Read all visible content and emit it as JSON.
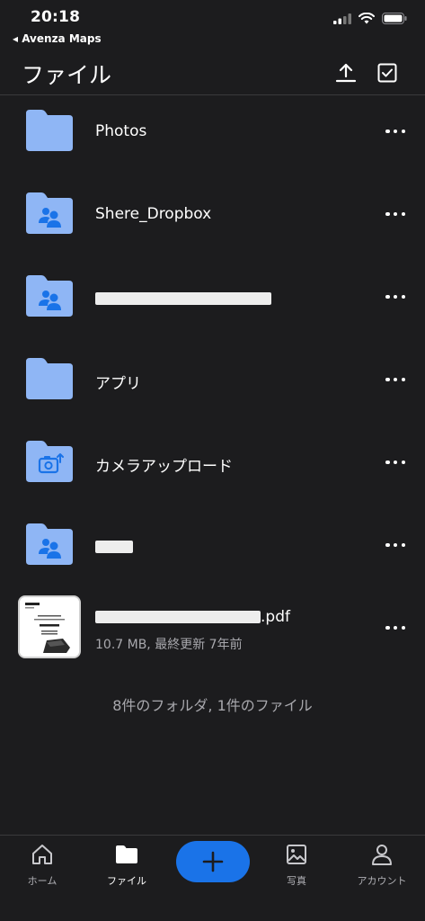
{
  "status": {
    "time": "20:18",
    "back_app": "◂ Avenza Maps"
  },
  "nav": {
    "title": "ファイル",
    "upload_icon": "upload-icon",
    "select_icon": "checkbox-icon"
  },
  "items": [
    {
      "name": "Photos",
      "icon": "folder-icon"
    },
    {
      "name": "Shere_Dropbox",
      "icon": "shared-folder-icon"
    },
    {
      "name": "",
      "icon": "shared-folder-icon"
    },
    {
      "name": "アプリ",
      "icon": "folder-icon"
    },
    {
      "name": "カメラアップロード",
      "icon": "camera-upload-folder-icon"
    },
    {
      "name": "",
      "icon": "shared-folder-icon"
    },
    {
      "name": ".pdf",
      "detail": "10.7 MB, 最終更新 7年前",
      "icon": "pdf-thumbnail"
    }
  ],
  "summary": "8件のフォルダ, 1件のファイル",
  "tabs": [
    {
      "label": "ホーム",
      "icon": "home-icon"
    },
    {
      "label": "ファイル",
      "icon": "folder-icon",
      "active": true
    },
    {
      "label": "",
      "icon": "plus-icon"
    },
    {
      "label": "写真",
      "icon": "photo-icon"
    },
    {
      "label": "アカウント",
      "icon": "person-icon"
    }
  ],
  "colors": {
    "background": "#1c1c1e",
    "folder": "#8fb6f5",
    "folder_glyph": "#1a73e8",
    "accent": "#1a73e8",
    "secondary_text": "#a8a8ad"
  }
}
